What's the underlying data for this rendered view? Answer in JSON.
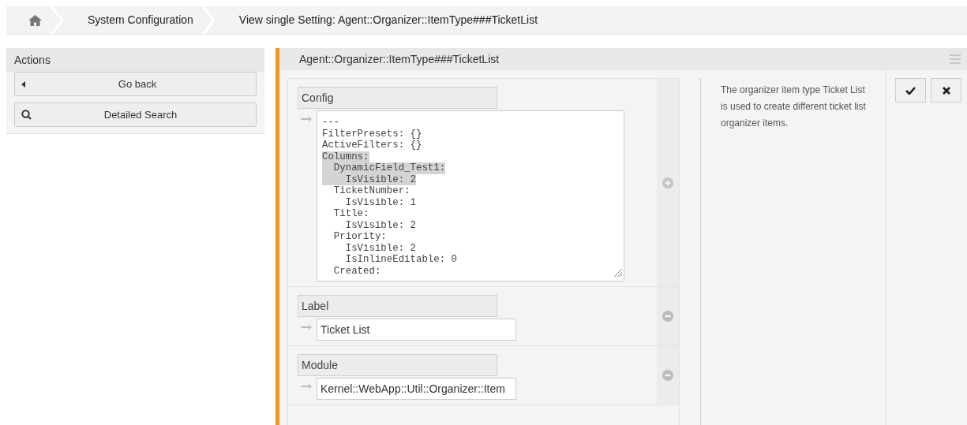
{
  "breadcrumb": [
    {
      "kind": "home"
    },
    {
      "kind": "text",
      "label": "System Configuration"
    },
    {
      "kind": "text",
      "label": "View single Setting: Agent::Organizer::ItemType###TicketList"
    }
  ],
  "sidebar": {
    "title": "Actions",
    "buttons": [
      {
        "kind": "back",
        "label": "Go back"
      },
      {
        "kind": "search",
        "label": "Detailed Search"
      }
    ]
  },
  "setting": {
    "title": "Agent::Organizer::ItemType###TicketList",
    "items": [
      {
        "kind": "code",
        "label": "Config",
        "removable": false,
        "lines": [
          {
            "text": "---",
            "selected": false
          },
          {
            "text": "FilterPresets: {}",
            "selected": false
          },
          {
            "text": "ActiveFilters: {}",
            "selected": false
          },
          {
            "text": "Columns:",
            "selected": true
          },
          {
            "text": "  DynamicField_Test1:",
            "selected": true
          },
          {
            "text": "    IsVisible: 2",
            "selected": true
          },
          {
            "text": "  TicketNumber:",
            "selected": false
          },
          {
            "text": "    IsVisible: 1",
            "selected": false
          },
          {
            "text": "  Title:",
            "selected": false
          },
          {
            "text": "    IsVisible: 2",
            "selected": false
          },
          {
            "text": "  Priority:",
            "selected": false
          },
          {
            "text": "    IsVisible: 2",
            "selected": false
          },
          {
            "text": "    IsInlineEditable: 0",
            "selected": false
          },
          {
            "text": "  Created:",
            "selected": false
          }
        ]
      },
      {
        "kind": "text",
        "label": "Label",
        "removable": true,
        "value": "Ticket List"
      },
      {
        "kind": "text",
        "label": "Module",
        "removable": true,
        "value": "Kernel::WebApp::Util::Organizer::Item"
      }
    ],
    "description": "The organizer item type Ticket List is used to create different ticket list organizer items.",
    "buttons": [
      {
        "kind": "save"
      },
      {
        "kind": "cancel"
      }
    ]
  }
}
